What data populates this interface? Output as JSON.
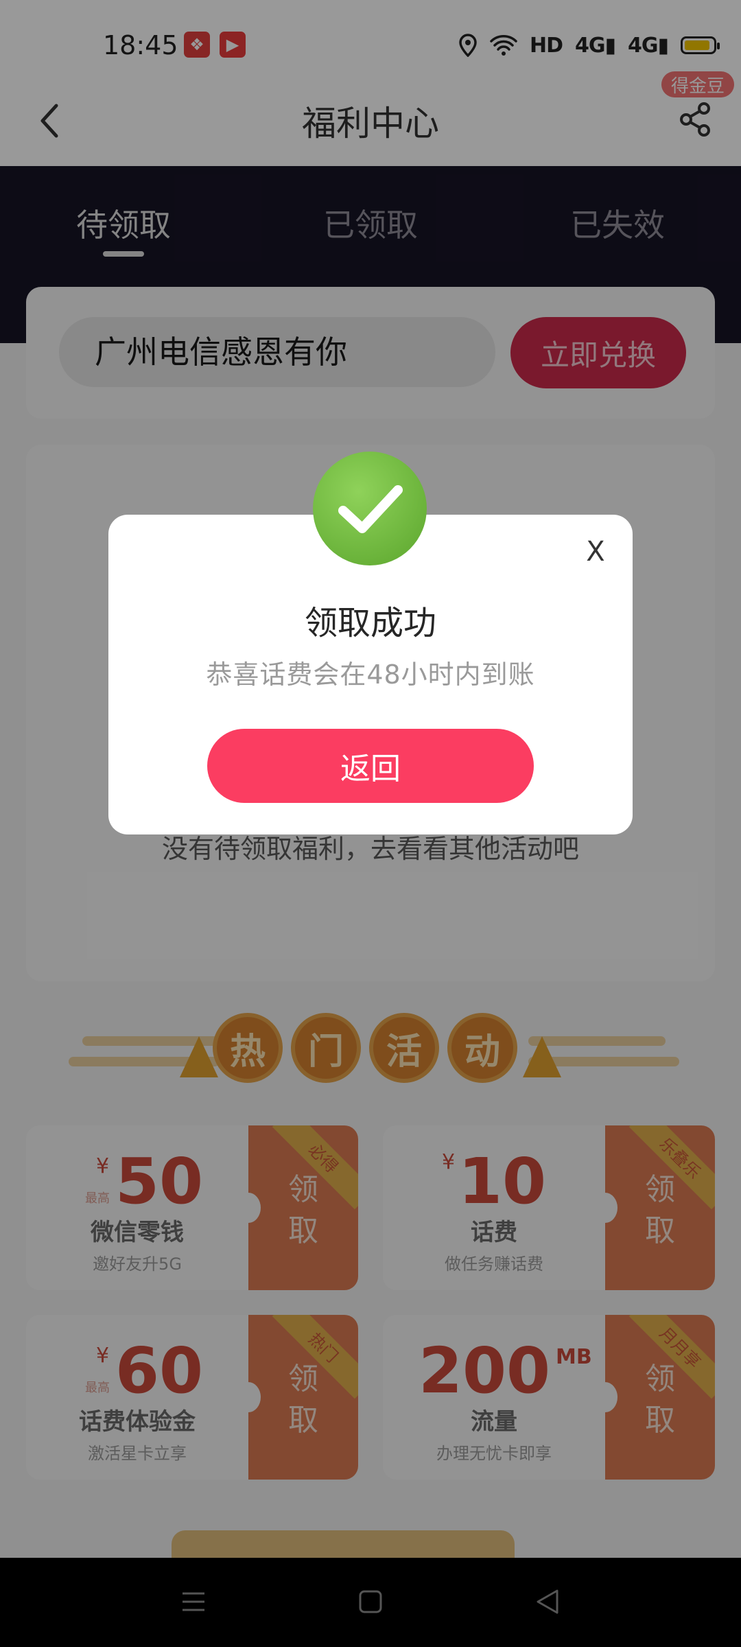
{
  "status_bar": {
    "time": "18:45",
    "network": [
      "HD",
      "4G",
      "4G"
    ],
    "battery_level": 0.7,
    "app_icon_colors": [
      "#e2403f",
      "#ea3d3d"
    ]
  },
  "header": {
    "title": "福利中心",
    "badge": "得金豆"
  },
  "tabs": [
    {
      "label": "待领取",
      "active": true
    },
    {
      "label": "已领取",
      "active": false
    },
    {
      "label": "已失效",
      "active": false
    }
  ],
  "exchange": {
    "input_value": "广州电信感恩有你",
    "button_label": "立即兑换"
  },
  "empty_text": "没有待领取福利，去看看其他活动吧",
  "hot_activities": {
    "chars": [
      "热",
      "门",
      "活",
      "动"
    ]
  },
  "coupons": [
    {
      "currency": "¥",
      "prefix": "最高",
      "amount": "50",
      "unit": "",
      "name": "微信零钱",
      "desc": "邀好友升5G",
      "claim": "领取",
      "ribbon": "必得"
    },
    {
      "currency": "¥",
      "prefix": "",
      "amount": "10",
      "unit": "",
      "name": "话费",
      "desc": "做任务赚话费",
      "claim": "领取",
      "ribbon": "乐叠乐"
    },
    {
      "currency": "¥",
      "prefix": "最高",
      "amount": "60",
      "unit": "",
      "name": "话费体验金",
      "desc": "激活星卡立享",
      "claim": "领取",
      "ribbon": "热门"
    },
    {
      "currency": "",
      "prefix": "",
      "amount": "200",
      "unit": "MB",
      "name": "流量",
      "desc": "办理无忧卡即享",
      "claim": "领取",
      "ribbon": "月月享"
    }
  ],
  "modal": {
    "close": "X",
    "title": "领取成功",
    "subtitle": "恭喜话费会在48小时内到账",
    "button": "返回"
  },
  "colors": {
    "accent": "#fb3d61",
    "band": "#171426",
    "success": "#6cbd3e"
  },
  "icons": [
    "location-icon",
    "wifi-icon",
    "signal-icon",
    "battery-icon",
    "back-icon",
    "share-icon",
    "check-icon",
    "menu-icon",
    "home-icon",
    "back-triangle-icon"
  ]
}
